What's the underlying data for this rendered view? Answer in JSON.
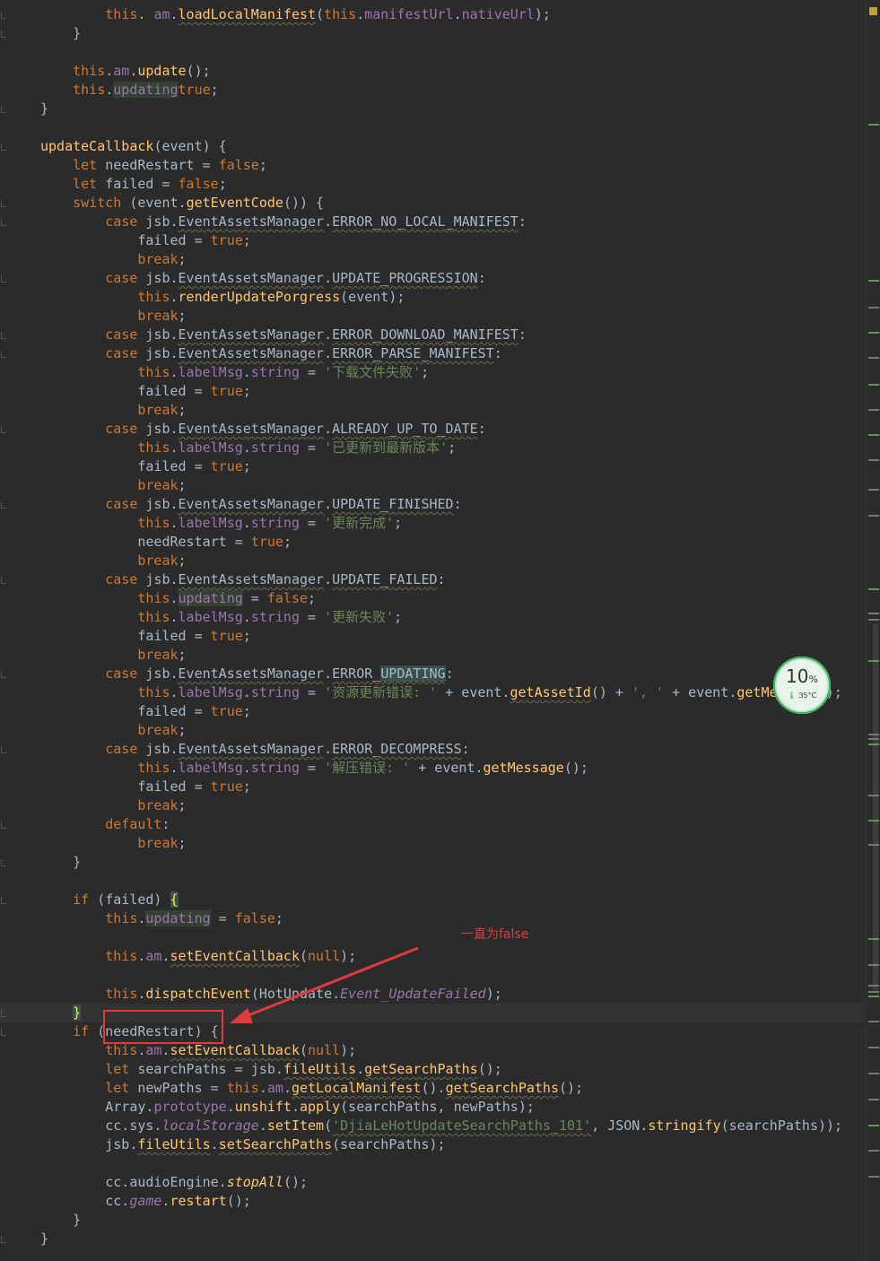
{
  "editor": {
    "lines": [
      [
        [
          "",
          "        "
        ],
        [
          "kw",
          "this"
        ],
        [
          "",
          ". "
        ],
        [
          "prop",
          "am"
        ],
        [
          "",
          "."
        ],
        [
          "fn und",
          "loadLocalManifest"
        ],
        [
          "",
          "("
        ],
        [
          "kw",
          "this"
        ],
        [
          "",
          "."
        ],
        [
          "prop",
          "manifestUrl"
        ],
        [
          "",
          "."
        ],
        [
          "prop",
          "nativeUrl"
        ],
        [
          "",
          ");"
        ]
      ],
      [
        [
          "",
          "    }"
        ]
      ],
      [
        [
          "",
          ""
        ]
      ],
      [
        [
          "",
          "    "
        ],
        [
          "kw",
          "this"
        ],
        [
          "",
          "."
        ],
        [
          "prop",
          "am"
        ],
        [
          "",
          "."
        ],
        [
          "fn",
          "update"
        ],
        [
          "",
          "();"
        ]
      ],
      [
        [
          "",
          "    "
        ],
        [
          "kw",
          "this"
        ],
        [
          "",
          "."
        ],
        [
          "prop hl",
          "updating"
        ],
        [
          "",
          "",
          " = "
        ],
        [
          "kw",
          "true"
        ],
        [
          "",
          ";"
        ]
      ],
      [
        [
          "",
          "}"
        ]
      ],
      [
        [
          "",
          ""
        ]
      ],
      [
        [
          "fn",
          "updateCallback"
        ],
        [
          "",
          "(event) {"
        ]
      ],
      [
        [
          "",
          "    "
        ],
        [
          "kw",
          "let"
        ],
        [
          "",
          " needRestart = "
        ],
        [
          "kw",
          "false"
        ],
        [
          "",
          ";"
        ]
      ],
      [
        [
          "",
          "    "
        ],
        [
          "kw",
          "let"
        ],
        [
          "",
          " failed = "
        ],
        [
          "kw",
          "false"
        ],
        [
          "",
          ";"
        ]
      ],
      [
        [
          "",
          "    "
        ],
        [
          "kw",
          "switch"
        ],
        [
          "",
          " (event."
        ],
        [
          "fn",
          "getEventCode"
        ],
        [
          "",
          "()) {"
        ]
      ],
      [
        [
          "",
          "        "
        ],
        [
          "kw",
          "case"
        ],
        [
          "",
          " jsb."
        ],
        [
          "und",
          "EventAssetsManager"
        ],
        [
          "",
          "."
        ],
        [
          "und",
          "ERROR_NO_LOCAL_MANIFEST"
        ],
        [
          "",
          ":"
        ]
      ],
      [
        [
          "",
          "            failed = "
        ],
        [
          "kw",
          "true"
        ],
        [
          "",
          ";"
        ]
      ],
      [
        [
          "",
          "            "
        ],
        [
          "kw",
          "break"
        ],
        [
          "",
          ";"
        ]
      ],
      [
        [
          "",
          "        "
        ],
        [
          "kw",
          "case"
        ],
        [
          "",
          " jsb."
        ],
        [
          "und",
          "EventAssetsManager"
        ],
        [
          "",
          "."
        ],
        [
          "und",
          "UPDATE_PROGRESSION"
        ],
        [
          "",
          ":"
        ]
      ],
      [
        [
          "",
          "            "
        ],
        [
          "kw",
          "this"
        ],
        [
          "",
          "."
        ],
        [
          "fn",
          "renderUpdatePorgress"
        ],
        [
          "",
          "(event);"
        ]
      ],
      [
        [
          "",
          "            "
        ],
        [
          "kw",
          "break"
        ],
        [
          "",
          ";"
        ]
      ],
      [
        [
          "",
          "        "
        ],
        [
          "kw",
          "case"
        ],
        [
          "",
          " jsb."
        ],
        [
          "und",
          "EventAssetsManager"
        ],
        [
          "",
          "."
        ],
        [
          "und",
          "ERROR_DOWNLOAD_MANIFEST"
        ],
        [
          "",
          ":"
        ]
      ],
      [
        [
          "",
          "        "
        ],
        [
          "kw",
          "case"
        ],
        [
          "",
          " jsb."
        ],
        [
          "und",
          "EventAssetsManager"
        ],
        [
          "",
          "."
        ],
        [
          "und",
          "ERROR_PARSE_MANIFEST"
        ],
        [
          "",
          ":"
        ]
      ],
      [
        [
          "",
          "            "
        ],
        [
          "kw",
          "this"
        ],
        [
          "",
          "."
        ],
        [
          "prop",
          "labelMsg"
        ],
        [
          "",
          "."
        ],
        [
          "prop",
          "string"
        ],
        [
          "",
          " = "
        ],
        [
          "str",
          "'下载文件失败'"
        ],
        [
          "",
          ";"
        ]
      ],
      [
        [
          "",
          "            failed = "
        ],
        [
          "kw",
          "true"
        ],
        [
          "",
          ";"
        ]
      ],
      [
        [
          "",
          "            "
        ],
        [
          "kw",
          "break"
        ],
        [
          "",
          ";"
        ]
      ],
      [
        [
          "",
          "        "
        ],
        [
          "kw",
          "case"
        ],
        [
          "",
          " jsb."
        ],
        [
          "und",
          "EventAssetsManager"
        ],
        [
          "",
          "."
        ],
        [
          "und",
          "ALREADY_UP_TO_DATE"
        ],
        [
          "",
          ":"
        ]
      ],
      [
        [
          "",
          "            "
        ],
        [
          "kw",
          "this"
        ],
        [
          "",
          "."
        ],
        [
          "prop",
          "labelMsg"
        ],
        [
          "",
          "."
        ],
        [
          "prop",
          "string"
        ],
        [
          "",
          " = "
        ],
        [
          "str",
          "'已更新到最新版本'"
        ],
        [
          "",
          ";"
        ]
      ],
      [
        [
          "",
          "            failed = "
        ],
        [
          "kw",
          "true"
        ],
        [
          "",
          ";"
        ]
      ],
      [
        [
          "",
          "            "
        ],
        [
          "kw",
          "break"
        ],
        [
          "",
          ";"
        ]
      ],
      [
        [
          "",
          "        "
        ],
        [
          "kw",
          "case"
        ],
        [
          "",
          " jsb."
        ],
        [
          "und",
          "EventAssetsManager"
        ],
        [
          "",
          "."
        ],
        [
          "und",
          "UPDATE_FINISHED"
        ],
        [
          "",
          ":"
        ]
      ],
      [
        [
          "",
          "            "
        ],
        [
          "kw",
          "this"
        ],
        [
          "",
          "."
        ],
        [
          "prop",
          "labelMsg"
        ],
        [
          "",
          "."
        ],
        [
          "prop",
          "string"
        ],
        [
          "",
          " = "
        ],
        [
          "str",
          "'更新完成'"
        ],
        [
          "",
          ";"
        ]
      ],
      [
        [
          "",
          "            needRestart = "
        ],
        [
          "kw",
          "true"
        ],
        [
          "",
          ";"
        ]
      ],
      [
        [
          "",
          "            "
        ],
        [
          "kw",
          "break"
        ],
        [
          "",
          ";"
        ]
      ],
      [
        [
          "",
          "        "
        ],
        [
          "kw",
          "case"
        ],
        [
          "",
          " jsb."
        ],
        [
          "und",
          "EventAssetsManager"
        ],
        [
          "",
          "."
        ],
        [
          "und",
          "UPDATE_FAILED"
        ],
        [
          "",
          ":"
        ]
      ],
      [
        [
          "",
          "            "
        ],
        [
          "kw",
          "this"
        ],
        [
          "",
          "."
        ],
        [
          "prop hl",
          "updating"
        ],
        [
          "",
          " = "
        ],
        [
          "kw",
          "false"
        ],
        [
          "",
          ";"
        ]
      ],
      [
        [
          "",
          "            "
        ],
        [
          "kw",
          "this"
        ],
        [
          "",
          "."
        ],
        [
          "prop",
          "labelMsg"
        ],
        [
          "",
          "."
        ],
        [
          "prop",
          "string"
        ],
        [
          "",
          " = "
        ],
        [
          "str",
          "'更新失败'"
        ],
        [
          "",
          ";"
        ]
      ],
      [
        [
          "",
          "            failed = "
        ],
        [
          "kw",
          "true"
        ],
        [
          "",
          ";"
        ]
      ],
      [
        [
          "",
          "            "
        ],
        [
          "kw",
          "break"
        ],
        [
          "",
          ";"
        ]
      ],
      [
        [
          "",
          "        "
        ],
        [
          "kw",
          "case"
        ],
        [
          "",
          " jsb."
        ],
        [
          "und",
          "EventAssetsManager"
        ],
        [
          "",
          "."
        ],
        [
          "und",
          "ERROR_"
        ],
        [
          "und hlb",
          "UPDATING"
        ],
        [
          "",
          ":"
        ]
      ],
      [
        [
          "",
          "            "
        ],
        [
          "kw",
          "this"
        ],
        [
          "",
          "."
        ],
        [
          "prop",
          "labelMsg"
        ],
        [
          "",
          "."
        ],
        [
          "prop",
          "string"
        ],
        [
          "",
          " = "
        ],
        [
          "str",
          "'资源更新错误: '"
        ],
        [
          "",
          " + event."
        ],
        [
          "fn und",
          "getAssetId"
        ],
        [
          "",
          "() + "
        ],
        [
          "str",
          "', '"
        ],
        [
          "",
          " + event."
        ],
        [
          "fn",
          "getMessage"
        ],
        [
          "",
          "();"
        ]
      ],
      [
        [
          "",
          "            failed = "
        ],
        [
          "kw",
          "true"
        ],
        [
          "",
          ";"
        ]
      ],
      [
        [
          "",
          "            "
        ],
        [
          "kw",
          "break"
        ],
        [
          "",
          ";"
        ]
      ],
      [
        [
          "",
          "        "
        ],
        [
          "kw",
          "case"
        ],
        [
          "",
          " jsb."
        ],
        [
          "und",
          "EventAssetsManager"
        ],
        [
          "",
          "."
        ],
        [
          "und",
          "ERROR_DECOMPRESS"
        ],
        [
          "",
          ":"
        ]
      ],
      [
        [
          "",
          "            "
        ],
        [
          "kw",
          "this"
        ],
        [
          "",
          "."
        ],
        [
          "prop",
          "labelMsg"
        ],
        [
          "",
          "."
        ],
        [
          "prop",
          "string"
        ],
        [
          "",
          " = "
        ],
        [
          "str",
          "'解压错误: '"
        ],
        [
          "",
          " + event."
        ],
        [
          "fn",
          "getMessage"
        ],
        [
          "",
          "();"
        ]
      ],
      [
        [
          "",
          "            failed = "
        ],
        [
          "kw",
          "true"
        ],
        [
          "",
          ";"
        ]
      ],
      [
        [
          "",
          "            "
        ],
        [
          "kw",
          "break"
        ],
        [
          "",
          ";"
        ]
      ],
      [
        [
          "",
          "        "
        ],
        [
          "kw",
          "default"
        ],
        [
          "",
          ":"
        ]
      ],
      [
        [
          "",
          "            "
        ],
        [
          "kw",
          "break"
        ],
        [
          "",
          ";"
        ]
      ],
      [
        [
          "",
          "    }"
        ]
      ],
      [
        [
          "",
          ""
        ]
      ],
      [
        [
          "",
          "    "
        ],
        [
          "kw",
          "if"
        ],
        [
          "",
          " (failed) "
        ],
        [
          "brace",
          "{"
        ]
      ],
      [
        [
          "",
          "        "
        ],
        [
          "kw",
          "this"
        ],
        [
          "",
          "."
        ],
        [
          "prop hl",
          "updating"
        ],
        [
          "",
          " = "
        ],
        [
          "kw",
          "false"
        ],
        [
          "",
          ";"
        ]
      ],
      [
        [
          "",
          ""
        ]
      ],
      [
        [
          "",
          "        "
        ],
        [
          "kw",
          "this"
        ],
        [
          "",
          "."
        ],
        [
          "prop",
          "am"
        ],
        [
          "",
          "."
        ],
        [
          "fn und",
          "setEventCallback"
        ],
        [
          "",
          "("
        ],
        [
          "kw",
          "null"
        ],
        [
          "",
          ");"
        ]
      ],
      [
        [
          "",
          ""
        ]
      ],
      [
        [
          "",
          "        "
        ],
        [
          "kw",
          "this"
        ],
        [
          "",
          "."
        ],
        [
          "fn",
          "dispatchEvent"
        ],
        [
          "",
          "(HotUpdate."
        ],
        [
          "prop ital",
          "Event_UpdateFailed"
        ],
        [
          "",
          ");"
        ]
      ],
      [
        [
          "",
          "    "
        ],
        [
          "brace",
          "}"
        ]
      ],
      [
        [
          "",
          "    "
        ],
        [
          "kw",
          "if"
        ],
        [
          "",
          " (needRestart) {"
        ]
      ],
      [
        [
          "",
          "        "
        ],
        [
          "kw",
          "this"
        ],
        [
          "",
          "."
        ],
        [
          "prop",
          "am"
        ],
        [
          "",
          "."
        ],
        [
          "fn und",
          "setEventCallback"
        ],
        [
          "",
          "("
        ],
        [
          "kw",
          "null"
        ],
        [
          "",
          ");"
        ]
      ],
      [
        [
          "",
          "        "
        ],
        [
          "kw",
          "let"
        ],
        [
          "",
          " searchPaths = jsb."
        ],
        [
          "fn und",
          "fileUtils"
        ],
        [
          "",
          "."
        ],
        [
          "fn und",
          "getSearchPaths"
        ],
        [
          "",
          "();"
        ]
      ],
      [
        [
          "",
          "        "
        ],
        [
          "kw",
          "let"
        ],
        [
          "",
          " newPaths = "
        ],
        [
          "kw",
          "this"
        ],
        [
          "",
          "."
        ],
        [
          "prop",
          "am"
        ],
        [
          "",
          "."
        ],
        [
          "fn und",
          "getLocalManifest"
        ],
        [
          "",
          "()."
        ],
        [
          "fn und",
          "getSearchPaths"
        ],
        [
          "",
          "();"
        ]
      ],
      [
        [
          "",
          "        Array."
        ],
        [
          "prop",
          "prototype"
        ],
        [
          "",
          "."
        ],
        [
          "fn",
          "unshift"
        ],
        [
          "",
          "."
        ],
        [
          "fn",
          "apply"
        ],
        [
          "",
          "(searchPaths, newPaths);"
        ]
      ],
      [
        [
          "",
          "        cc.sys."
        ],
        [
          "prop ital",
          "localStorage"
        ],
        [
          "",
          "."
        ],
        [
          "fn",
          "setItem"
        ],
        [
          "",
          "("
        ],
        [
          "str und",
          "'DjiaLeHotUpdateSearchPaths_101'"
        ],
        [
          "",
          ", JSON."
        ],
        [
          "fn",
          "stringify"
        ],
        [
          "",
          "(searchPaths));"
        ]
      ],
      [
        [
          "",
          "        jsb."
        ],
        [
          "fn und",
          "fileUtils"
        ],
        [
          "",
          "."
        ],
        [
          "fn und",
          "setSearchPaths"
        ],
        [
          "",
          "(searchPaths);"
        ]
      ],
      [
        [
          "",
          ""
        ]
      ],
      [
        [
          "",
          "        cc.audioEngine."
        ],
        [
          "fn ital",
          "stopAll"
        ],
        [
          "",
          "();"
        ]
      ],
      [
        [
          "",
          "        cc."
        ],
        [
          "prop ital",
          "game"
        ],
        [
          "",
          "."
        ],
        [
          "fn",
          "restart"
        ],
        [
          "",
          "();"
        ]
      ],
      [
        [
          "",
          "    }"
        ]
      ],
      [
        [
          "",
          "}"
        ]
      ]
    ]
  },
  "annotation": {
    "text": "一直为false"
  },
  "widget": {
    "percent": "10",
    "percent_unit": "%",
    "temperature": "35°C"
  }
}
